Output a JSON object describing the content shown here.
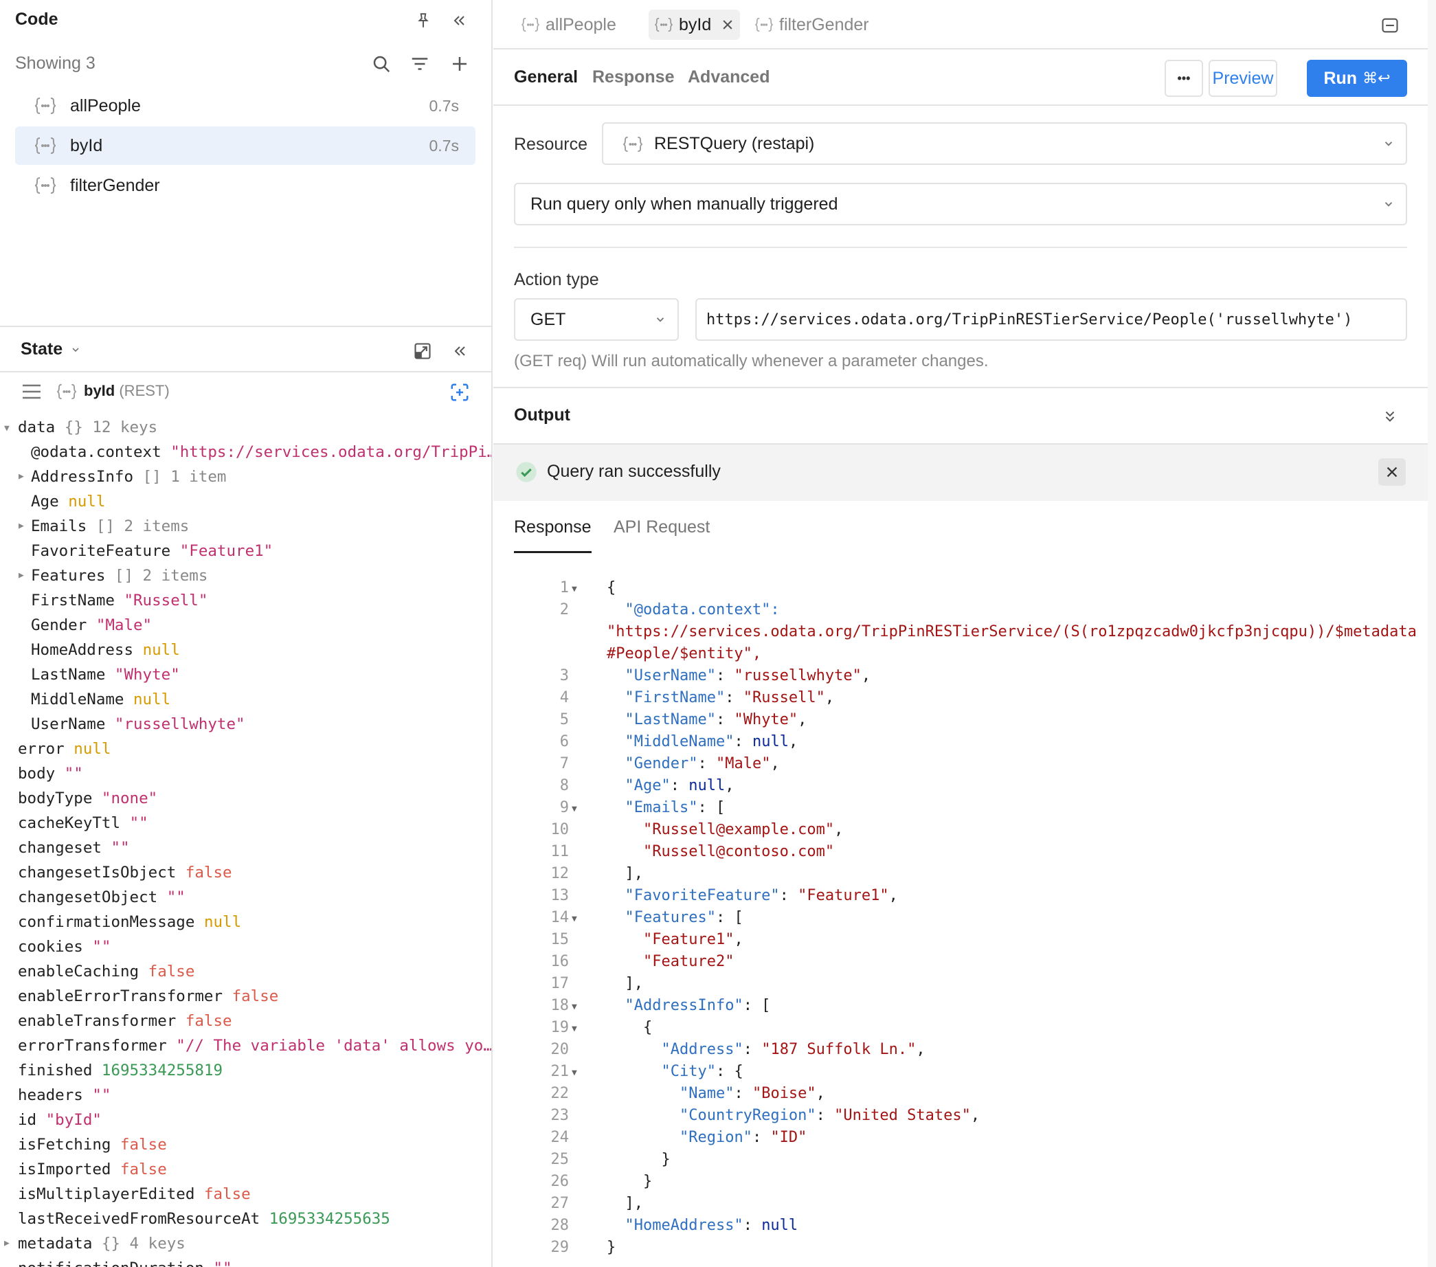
{
  "code_panel": {
    "title": "Code",
    "showing": "Showing 3",
    "queries": [
      {
        "name": "allPeople",
        "time": "0.7s"
      },
      {
        "name": "byId",
        "time": "0.7s"
      },
      {
        "name": "filterGender",
        "time": ""
      }
    ]
  },
  "state_panel": {
    "title": "State",
    "query_name": "byId",
    "query_type": "(REST)",
    "tree": {
      "data": {
        "key": "data",
        "meta": "{}  12 keys"
      },
      "odata_context": {
        "key": "@odata.context",
        "value": "\"https://services.odata.org/TripPi…"
      },
      "address_info": {
        "key": "AddressInfo",
        "meta": "[]  1 item"
      },
      "age": {
        "key": "Age",
        "value": "null"
      },
      "emails": {
        "key": "Emails",
        "meta": "[]  2 items"
      },
      "favorite_feature": {
        "key": "FavoriteFeature",
        "value": "\"Feature1\""
      },
      "features": {
        "key": "Features",
        "meta": "[]  2 items"
      },
      "first_name": {
        "key": "FirstName",
        "value": "\"Russell\""
      },
      "gender": {
        "key": "Gender",
        "value": "\"Male\""
      },
      "home_address": {
        "key": "HomeAddress",
        "value": "null"
      },
      "last_name": {
        "key": "LastName",
        "value": "\"Whyte\""
      },
      "middle_name": {
        "key": "MiddleName",
        "value": "null"
      },
      "user_name": {
        "key": "UserName",
        "value": "\"russellwhyte\""
      },
      "error": {
        "key": "error",
        "value": "null"
      },
      "body": {
        "key": "body",
        "value": "\"\""
      },
      "body_type": {
        "key": "bodyType",
        "value": "\"none\""
      },
      "cache_key_ttl": {
        "key": "cacheKeyTtl",
        "value": "\"\""
      },
      "changeset": {
        "key": "changeset",
        "value": "\"\""
      },
      "changeset_is_object": {
        "key": "changesetIsObject",
        "value": "false"
      },
      "changeset_object": {
        "key": "changesetObject",
        "value": "\"\""
      },
      "confirmation_message": {
        "key": "confirmationMessage",
        "value": "null"
      },
      "cookies": {
        "key": "cookies",
        "value": "\"\""
      },
      "enable_caching": {
        "key": "enableCaching",
        "value": "false"
      },
      "enable_error_transformer": {
        "key": "enableErrorTransformer",
        "value": "false"
      },
      "enable_transformer": {
        "key": "enableTransformer",
        "value": "false"
      },
      "error_transformer": {
        "key": "errorTransformer",
        "value": "\"// The variable 'data' allows yo…"
      },
      "finished": {
        "key": "finished",
        "value": "1695334255819"
      },
      "headers": {
        "key": "headers",
        "value": "\"\""
      },
      "id": {
        "key": "id",
        "value": "\"byId\""
      },
      "is_fetching": {
        "key": "isFetching",
        "value": "false"
      },
      "is_imported": {
        "key": "isImported",
        "value": "false"
      },
      "is_multiplayer_edited": {
        "key": "isMultiplayerEdited",
        "value": "false"
      },
      "last_received": {
        "key": "lastReceivedFromResourceAt",
        "value": "1695334255635"
      },
      "metadata": {
        "key": "metadata",
        "meta": "{}  4 keys"
      },
      "notification_duration": {
        "key": "notificationDuration",
        "value": "\"\""
      }
    }
  },
  "editor": {
    "tabs": [
      "allPeople",
      "byId",
      "filterGender"
    ],
    "subtabs": [
      "General",
      "Response",
      "Advanced"
    ],
    "more_label": "•••",
    "preview_label": "Preview",
    "run_label": "Run",
    "run_shortcut": "⌘↩",
    "resource_label": "Resource",
    "resource_value": "RESTQuery (restapi)",
    "trigger_value": "Run query only when manually triggered",
    "action_type_label": "Action type",
    "method": "GET",
    "url": "https://services.odata.org/TripPinRESTierService/People('russellwhyte')",
    "hint": "(GET req) Will run automatically whenever a parameter changes.",
    "output_label": "Output",
    "success_text": "Query ran successfully",
    "response_tabs": [
      "Response",
      "API Request"
    ]
  },
  "response_code": {
    "line_numbers": [
      "1",
      "2",
      "",
      "",
      "3",
      "4",
      "5",
      "6",
      "7",
      "8",
      "9",
      "10",
      "11",
      "12",
      "13",
      "14",
      "15",
      "16",
      "17",
      "18",
      "19",
      "20",
      "21",
      "22",
      "23",
      "24",
      "25",
      "26",
      "27",
      "28",
      "29"
    ],
    "lines": [
      "{",
      "  \"@odata.context\":",
      "\"https://services.odata.org/TripPinRESTierService/(S(ro1zpqzcadw0jkcfp3njcqpu))/$metadata",
      "#People/$entity\",",
      "  \"UserName\": \"russellwhyte\",",
      "  \"FirstName\": \"Russell\",",
      "  \"LastName\": \"Whyte\",",
      "  \"MiddleName\": null,",
      "  \"Gender\": \"Male\",",
      "  \"Age\": null,",
      "  \"Emails\": [",
      "    \"Russell@example.com\",",
      "    \"Russell@contoso.com\"",
      "  ],",
      "  \"FavoriteFeature\": \"Feature1\",",
      "  \"Features\": [",
      "    \"Feature1\",",
      "    \"Feature2\"",
      "  ],",
      "  \"AddressInfo\": [",
      "    {",
      "      \"Address\": \"187 Suffolk Ln.\",",
      "      \"City\": {",
      "        \"Name\": \"Boise\",",
      "        \"CountryRegion\": \"United States\",",
      "        \"Region\": \"ID\"",
      "      }",
      "    }",
      "  ],",
      "  \"HomeAddress\": null",
      "}"
    ]
  },
  "colors": {
    "accent": "#2f80ed",
    "selected_bg": "#ebf1fb",
    "success": "#3a9a55"
  }
}
